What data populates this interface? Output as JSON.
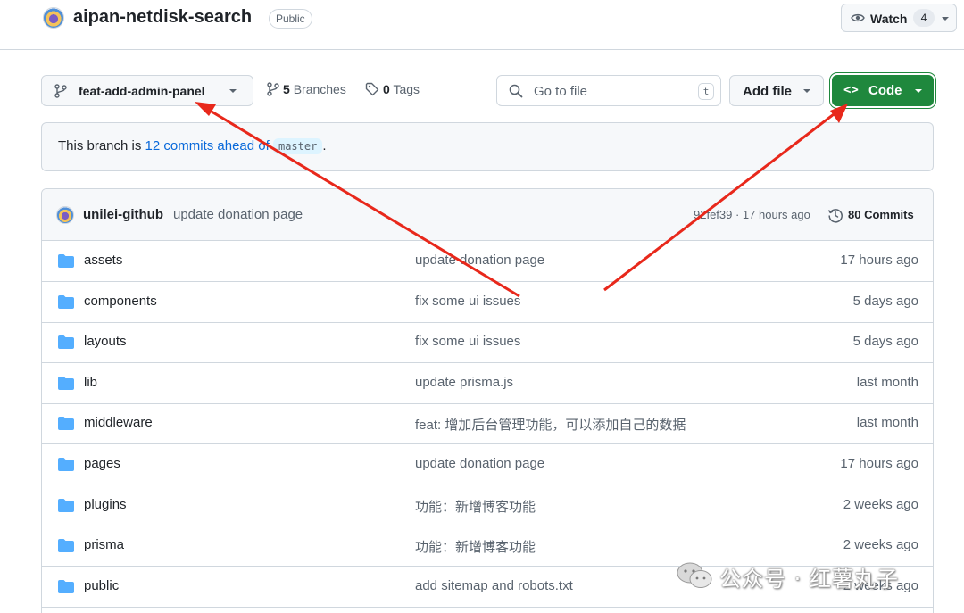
{
  "repo": {
    "name": "aipan-netdisk-search",
    "visibility": "Public",
    "watch_label": "Watch",
    "watch_count": "4"
  },
  "toolbar": {
    "branch": "feat-add-admin-panel",
    "branches_count": "5",
    "branches_label": "Branches",
    "tags_count": "0",
    "tags_label": "Tags",
    "goto_placeholder": "Go to file",
    "goto_shortcut": "t",
    "add_file_label": "Add file",
    "code_label": "Code"
  },
  "branch_info": {
    "prefix": "This branch is",
    "ahead_link": "12 commits ahead of",
    "base": "master",
    "suffix": "."
  },
  "latest_commit": {
    "author": "unilei-github",
    "message": "update donation page",
    "hash_time": "92fef39 · 17 hours ago",
    "commits_count": "80 Commits"
  },
  "files": [
    {
      "name": "assets",
      "message": "update donation page",
      "date": "17 hours ago"
    },
    {
      "name": "components",
      "message": "fix some ui issues",
      "date": "5 days ago"
    },
    {
      "name": "layouts",
      "message": "fix some ui issues",
      "date": "5 days ago"
    },
    {
      "name": "lib",
      "message": "update prisma.js",
      "date": "last month"
    },
    {
      "name": "middleware",
      "message": "feat: 增加后台管理功能，可以添加自己的数据",
      "date": "last month"
    },
    {
      "name": "pages",
      "message": "update donation page",
      "date": "17 hours ago"
    },
    {
      "name": "plugins",
      "message": "功能：新增博客功能",
      "date": "2 weeks ago"
    },
    {
      "name": "prisma",
      "message": "功能：新增博客功能",
      "date": "2 weeks ago"
    },
    {
      "name": "public",
      "message": "add sitemap and robots.txt",
      "date": "2 weeks ago"
    }
  ],
  "watermark": {
    "text": "公众号 · 红薯丸子"
  },
  "colors": {
    "accent_green": "#1f883d",
    "link_blue": "#0969da",
    "folder_blue": "#54aeff",
    "annotation_red": "#e8281b"
  },
  "icons": [
    "repo-avatar",
    "eye-icon",
    "branch-icon",
    "tag-icon",
    "search-icon",
    "code-icon",
    "history-icon",
    "folder-icon",
    "wechat-logo"
  ]
}
